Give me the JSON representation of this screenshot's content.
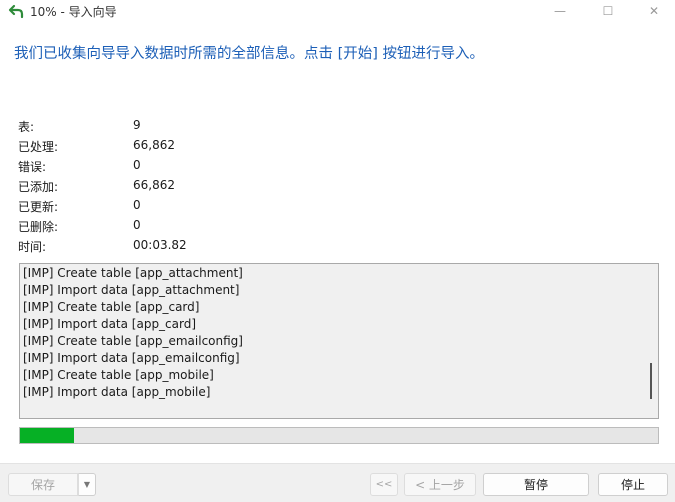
{
  "window": {
    "title": "10% - 导入向导",
    "minimize_glyph": "—",
    "maximize_glyph": "☐",
    "close_glyph": "✕"
  },
  "headline": "我们已收集向导导入数据时所需的全部信息。点击 [开始] 按钮进行导入。",
  "stats": [
    {
      "label": "表:",
      "value": "9"
    },
    {
      "label": "已处理:",
      "value": "66,862"
    },
    {
      "label": "错误:",
      "value": "0"
    },
    {
      "label": "已添加:",
      "value": "66,862"
    },
    {
      "label": "已更新:",
      "value": "0"
    },
    {
      "label": "已删除:",
      "value": "0"
    },
    {
      "label": "时间:",
      "value": "00:03.82"
    }
  ],
  "log": [
    "[IMP] Create table [app_attachment]",
    "[IMP] Import data [app_attachment]",
    "[IMP] Create table [app_card]",
    "[IMP] Import data [app_card]",
    "[IMP] Create table [app_emailconfig]",
    "[IMP] Import data [app_emailconfig]",
    "[IMP] Create table [app_mobile]",
    "[IMP] Import data [app_mobile]"
  ],
  "progress": {
    "fraction": 0.085,
    "color": "#06b025"
  },
  "footer": {
    "save_label": "保存",
    "save_dropdown_glyph": "▼",
    "first_label": "<<",
    "prev_label": "< 上一步",
    "pause_label": "暂停",
    "stop_label": "停止"
  },
  "colors": {
    "accent": "#1c5fb7",
    "icon": "#2e8b3a"
  },
  "icons": {
    "app": "undo-arrow-icon"
  }
}
